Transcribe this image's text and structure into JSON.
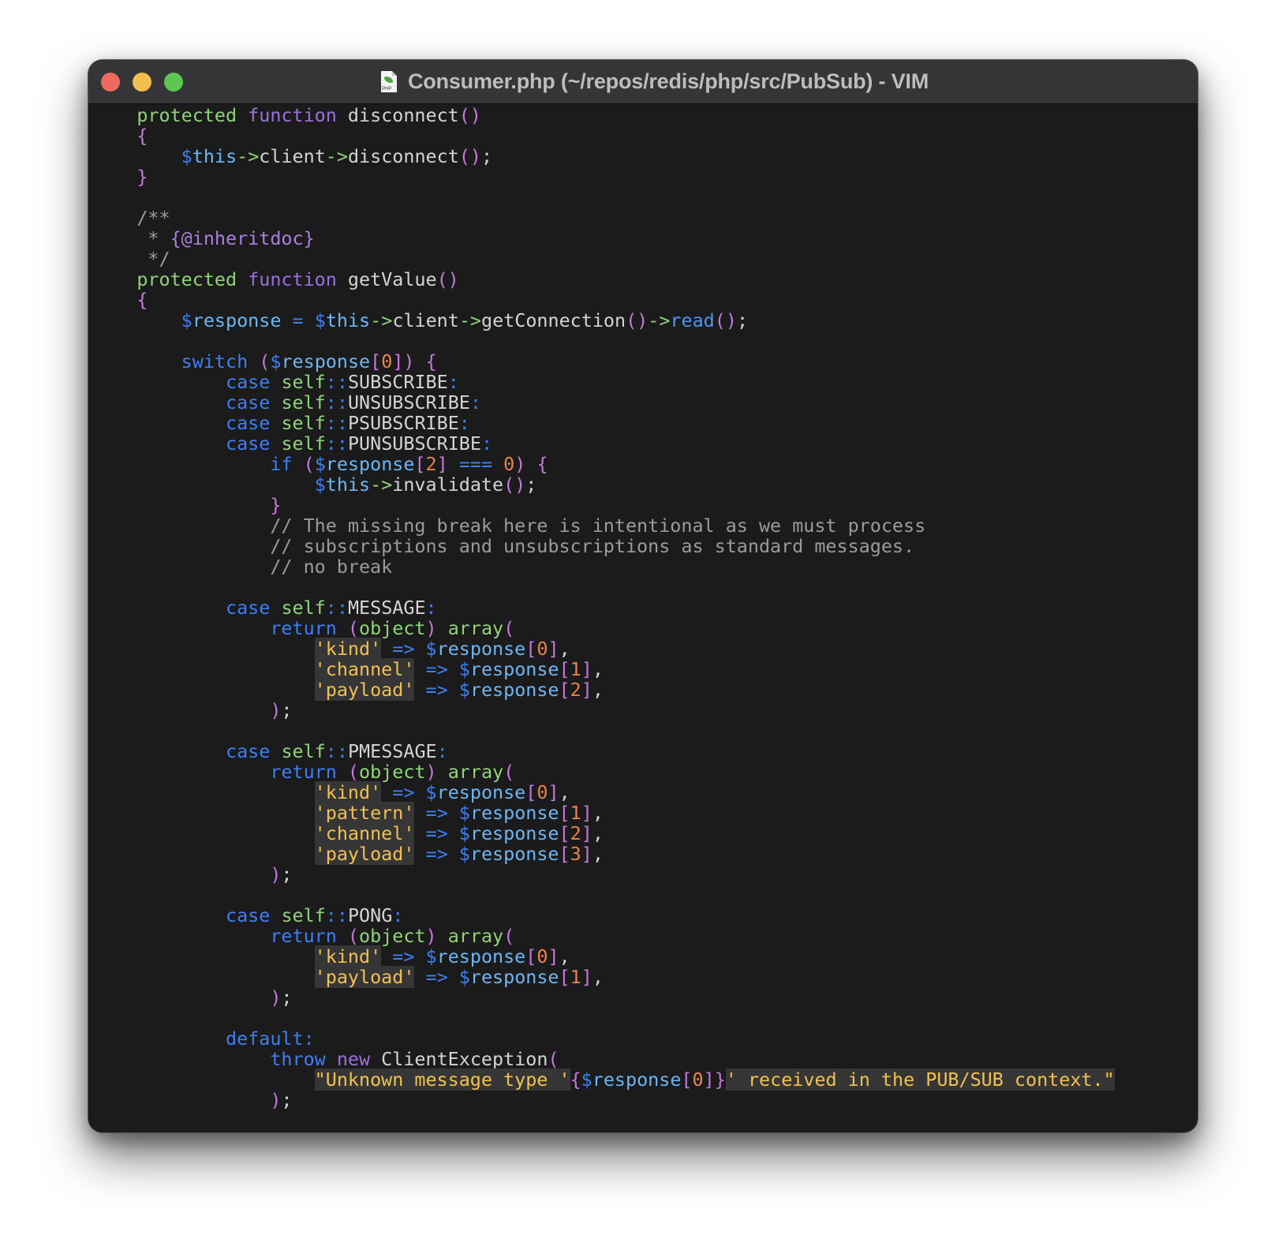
{
  "window": {
    "title": "Consumer.php (~/repos/redis/php/src/PubSub) - VIM",
    "file_icon": "php-file-icon",
    "file_icon_label": "PHP",
    "traffic_lights": [
      {
        "name": "close",
        "color": "#ee6a5f"
      },
      {
        "name": "minimize",
        "color": "#f4bf4f"
      },
      {
        "name": "maximize",
        "color": "#5fc553"
      }
    ]
  },
  "editor": {
    "language": "php",
    "colors": {
      "background": "#1b1b1b",
      "default": "#d4d4d4",
      "storage": "#8fd47a",
      "keyword": "#9d6fe0",
      "control": "#3d7ff5",
      "variable": "#6cb6f5",
      "paren": "#c678dd",
      "number": "#e8834e",
      "comment": "#9b9b9b",
      "string": "#f2c14e"
    },
    "lines": [
      [
        [
          "storage",
          "    protected"
        ],
        [
          "default",
          " "
        ],
        [
          "keyword",
          "function"
        ],
        [
          "default",
          " disconnect"
        ],
        [
          "paren",
          "()"
        ]
      ],
      [
        [
          "paren",
          "    {"
        ]
      ],
      [
        [
          "default",
          "        "
        ],
        [
          "dollar",
          "$"
        ],
        [
          "var",
          "this"
        ],
        [
          "storage",
          "->"
        ],
        [
          "default",
          "client"
        ],
        [
          "storage",
          "->"
        ],
        [
          "default",
          "disconnect"
        ],
        [
          "paren",
          "()"
        ],
        [
          "default",
          ";"
        ]
      ],
      [
        [
          "paren",
          "    }"
        ]
      ],
      [],
      [
        [
          "comment",
          "    /**"
        ]
      ],
      [
        [
          "comment",
          "     * "
        ],
        [
          "doctag",
          "{@inheritdoc}"
        ]
      ],
      [
        [
          "comment",
          "     */"
        ]
      ],
      [
        [
          "storage",
          "    protected"
        ],
        [
          "default",
          " "
        ],
        [
          "keyword",
          "function"
        ],
        [
          "default",
          " getValue"
        ],
        [
          "paren",
          "()"
        ]
      ],
      [
        [
          "paren",
          "    {"
        ]
      ],
      [
        [
          "default",
          "        "
        ],
        [
          "dollar",
          "$"
        ],
        [
          "var",
          "response"
        ],
        [
          "default",
          " "
        ],
        [
          "control",
          "="
        ],
        [
          "default",
          " "
        ],
        [
          "dollar",
          "$"
        ],
        [
          "var",
          "this"
        ],
        [
          "storage",
          "->"
        ],
        [
          "default",
          "client"
        ],
        [
          "storage",
          "->"
        ],
        [
          "default",
          "getConnection"
        ],
        [
          "paren",
          "()"
        ],
        [
          "storage",
          "->"
        ],
        [
          "builtin",
          "read"
        ],
        [
          "paren",
          "()"
        ],
        [
          "default",
          ";"
        ]
      ],
      [],
      [
        [
          "default",
          "        "
        ],
        [
          "control",
          "switch"
        ],
        [
          "default",
          " "
        ],
        [
          "paren",
          "("
        ],
        [
          "dollar",
          "$"
        ],
        [
          "var",
          "response"
        ],
        [
          "paren",
          "["
        ],
        [
          "number",
          "0"
        ],
        [
          "paren",
          "])"
        ],
        [
          "default",
          " "
        ],
        [
          "paren",
          "{"
        ]
      ],
      [
        [
          "default",
          "            "
        ],
        [
          "control",
          "case"
        ],
        [
          "default",
          " "
        ],
        [
          "storage",
          "self"
        ],
        [
          "control",
          "::"
        ],
        [
          "default",
          "SUBSCRIBE"
        ],
        [
          "control",
          ":"
        ]
      ],
      [
        [
          "default",
          "            "
        ],
        [
          "control",
          "case"
        ],
        [
          "default",
          " "
        ],
        [
          "storage",
          "self"
        ],
        [
          "control",
          "::"
        ],
        [
          "default",
          "UNSUBSCRIBE"
        ],
        [
          "control",
          ":"
        ]
      ],
      [
        [
          "default",
          "            "
        ],
        [
          "control",
          "case"
        ],
        [
          "default",
          " "
        ],
        [
          "storage",
          "self"
        ],
        [
          "control",
          "::"
        ],
        [
          "default",
          "PSUBSCRIBE"
        ],
        [
          "control",
          ":"
        ]
      ],
      [
        [
          "default",
          "            "
        ],
        [
          "control",
          "case"
        ],
        [
          "default",
          " "
        ],
        [
          "storage",
          "self"
        ],
        [
          "control",
          "::"
        ],
        [
          "default",
          "PUNSUBSCRIBE"
        ],
        [
          "control",
          ":"
        ]
      ],
      [
        [
          "default",
          "                "
        ],
        [
          "control",
          "if"
        ],
        [
          "default",
          " "
        ],
        [
          "paren",
          "("
        ],
        [
          "dollar",
          "$"
        ],
        [
          "var",
          "response"
        ],
        [
          "paren",
          "["
        ],
        [
          "number",
          "2"
        ],
        [
          "paren",
          "]"
        ],
        [
          "default",
          " "
        ],
        [
          "control",
          "==="
        ],
        [
          "default",
          " "
        ],
        [
          "number",
          "0"
        ],
        [
          "paren",
          ")"
        ],
        [
          "default",
          " "
        ],
        [
          "paren",
          "{"
        ]
      ],
      [
        [
          "default",
          "                    "
        ],
        [
          "dollar",
          "$"
        ],
        [
          "var",
          "this"
        ],
        [
          "storage",
          "->"
        ],
        [
          "default",
          "invalidate"
        ],
        [
          "paren",
          "()"
        ],
        [
          "default",
          ";"
        ]
      ],
      [
        [
          "paren",
          "                }"
        ]
      ],
      [
        [
          "comment",
          "                // The missing break here is intentional as we must process"
        ]
      ],
      [
        [
          "comment",
          "                // subscriptions and unsubscriptions as standard messages."
        ]
      ],
      [
        [
          "comment",
          "                // no break"
        ]
      ],
      [],
      [
        [
          "default",
          "            "
        ],
        [
          "control",
          "case"
        ],
        [
          "default",
          " "
        ],
        [
          "storage",
          "self"
        ],
        [
          "control",
          "::"
        ],
        [
          "default",
          "MESSAGE"
        ],
        [
          "control",
          ":"
        ]
      ],
      [
        [
          "default",
          "                "
        ],
        [
          "control",
          "return"
        ],
        [
          "default",
          " "
        ],
        [
          "paren",
          "("
        ],
        [
          "storage",
          "object"
        ],
        [
          "paren",
          ")"
        ],
        [
          "default",
          " "
        ],
        [
          "storage",
          "array"
        ],
        [
          "paren",
          "("
        ]
      ],
      [
        [
          "default",
          "                    "
        ],
        [
          "string",
          "'kind'"
        ],
        [
          "default",
          " "
        ],
        [
          "control",
          "=>"
        ],
        [
          "default",
          " "
        ],
        [
          "dollar",
          "$"
        ],
        [
          "var",
          "response"
        ],
        [
          "paren",
          "["
        ],
        [
          "number",
          "0"
        ],
        [
          "paren",
          "]"
        ],
        [
          "default",
          ","
        ]
      ],
      [
        [
          "default",
          "                    "
        ],
        [
          "string",
          "'channel'"
        ],
        [
          "default",
          " "
        ],
        [
          "control",
          "=>"
        ],
        [
          "default",
          " "
        ],
        [
          "dollar",
          "$"
        ],
        [
          "var",
          "response"
        ],
        [
          "paren",
          "["
        ],
        [
          "number",
          "1"
        ],
        [
          "paren",
          "]"
        ],
        [
          "default",
          ","
        ]
      ],
      [
        [
          "default",
          "                    "
        ],
        [
          "string",
          "'payload'"
        ],
        [
          "default",
          " "
        ],
        [
          "control",
          "=>"
        ],
        [
          "default",
          " "
        ],
        [
          "dollar",
          "$"
        ],
        [
          "var",
          "response"
        ],
        [
          "paren",
          "["
        ],
        [
          "number",
          "2"
        ],
        [
          "paren",
          "]"
        ],
        [
          "default",
          ","
        ]
      ],
      [
        [
          "paren",
          "                )"
        ],
        [
          "default",
          ";"
        ]
      ],
      [],
      [
        [
          "default",
          "            "
        ],
        [
          "control",
          "case"
        ],
        [
          "default",
          " "
        ],
        [
          "storage",
          "self"
        ],
        [
          "control",
          "::"
        ],
        [
          "default",
          "PMESSAGE"
        ],
        [
          "control",
          ":"
        ]
      ],
      [
        [
          "default",
          "                "
        ],
        [
          "control",
          "return"
        ],
        [
          "default",
          " "
        ],
        [
          "paren",
          "("
        ],
        [
          "storage",
          "object"
        ],
        [
          "paren",
          ")"
        ],
        [
          "default",
          " "
        ],
        [
          "storage",
          "array"
        ],
        [
          "paren",
          "("
        ]
      ],
      [
        [
          "default",
          "                    "
        ],
        [
          "string",
          "'kind'"
        ],
        [
          "default",
          " "
        ],
        [
          "control",
          "=>"
        ],
        [
          "default",
          " "
        ],
        [
          "dollar",
          "$"
        ],
        [
          "var",
          "response"
        ],
        [
          "paren",
          "["
        ],
        [
          "number",
          "0"
        ],
        [
          "paren",
          "]"
        ],
        [
          "default",
          ","
        ]
      ],
      [
        [
          "default",
          "                    "
        ],
        [
          "string",
          "'pattern'"
        ],
        [
          "default",
          " "
        ],
        [
          "control",
          "=>"
        ],
        [
          "default",
          " "
        ],
        [
          "dollar",
          "$"
        ],
        [
          "var",
          "response"
        ],
        [
          "paren",
          "["
        ],
        [
          "number",
          "1"
        ],
        [
          "paren",
          "]"
        ],
        [
          "default",
          ","
        ]
      ],
      [
        [
          "default",
          "                    "
        ],
        [
          "string",
          "'channel'"
        ],
        [
          "default",
          " "
        ],
        [
          "control",
          "=>"
        ],
        [
          "default",
          " "
        ],
        [
          "dollar",
          "$"
        ],
        [
          "var",
          "response"
        ],
        [
          "paren",
          "["
        ],
        [
          "number",
          "2"
        ],
        [
          "paren",
          "]"
        ],
        [
          "default",
          ","
        ]
      ],
      [
        [
          "default",
          "                    "
        ],
        [
          "string",
          "'payload'"
        ],
        [
          "default",
          " "
        ],
        [
          "control",
          "=>"
        ],
        [
          "default",
          " "
        ],
        [
          "dollar",
          "$"
        ],
        [
          "var",
          "response"
        ],
        [
          "paren",
          "["
        ],
        [
          "number",
          "3"
        ],
        [
          "paren",
          "]"
        ],
        [
          "default",
          ","
        ]
      ],
      [
        [
          "paren",
          "                )"
        ],
        [
          "default",
          ";"
        ]
      ],
      [],
      [
        [
          "default",
          "            "
        ],
        [
          "control",
          "case"
        ],
        [
          "default",
          " "
        ],
        [
          "storage",
          "self"
        ],
        [
          "control",
          "::"
        ],
        [
          "default",
          "PONG"
        ],
        [
          "control",
          ":"
        ]
      ],
      [
        [
          "default",
          "                "
        ],
        [
          "control",
          "return"
        ],
        [
          "default",
          " "
        ],
        [
          "paren",
          "("
        ],
        [
          "storage",
          "object"
        ],
        [
          "paren",
          ")"
        ],
        [
          "default",
          " "
        ],
        [
          "storage",
          "array"
        ],
        [
          "paren",
          "("
        ]
      ],
      [
        [
          "default",
          "                    "
        ],
        [
          "string",
          "'kind'"
        ],
        [
          "default",
          " "
        ],
        [
          "control",
          "=>"
        ],
        [
          "default",
          " "
        ],
        [
          "dollar",
          "$"
        ],
        [
          "var",
          "response"
        ],
        [
          "paren",
          "["
        ],
        [
          "number",
          "0"
        ],
        [
          "paren",
          "]"
        ],
        [
          "default",
          ","
        ]
      ],
      [
        [
          "default",
          "                    "
        ],
        [
          "string",
          "'payload'"
        ],
        [
          "default",
          " "
        ],
        [
          "control",
          "=>"
        ],
        [
          "default",
          " "
        ],
        [
          "dollar",
          "$"
        ],
        [
          "var",
          "response"
        ],
        [
          "paren",
          "["
        ],
        [
          "number",
          "1"
        ],
        [
          "paren",
          "]"
        ],
        [
          "default",
          ","
        ]
      ],
      [
        [
          "paren",
          "                )"
        ],
        [
          "default",
          ";"
        ]
      ],
      [],
      [
        [
          "default",
          "            "
        ],
        [
          "control",
          "default:"
        ]
      ],
      [
        [
          "default",
          "                "
        ],
        [
          "control",
          "throw"
        ],
        [
          "default",
          " "
        ],
        [
          "keyword",
          "new"
        ],
        [
          "default",
          " ClientException"
        ],
        [
          "paren",
          "("
        ]
      ],
      [
        [
          "default",
          "                    "
        ],
        [
          "string",
          "\"Unknown message type '"
        ],
        [
          "paren",
          "{"
        ],
        [
          "dollar",
          "$"
        ],
        [
          "var",
          "response"
        ],
        [
          "paren",
          "["
        ],
        [
          "number",
          "0"
        ],
        [
          "paren",
          "]}"
        ],
        [
          "string",
          "' received in the PUB/SUB context.\""
        ]
      ],
      [
        [
          "paren",
          "                )"
        ],
        [
          "default",
          ";"
        ]
      ]
    ]
  }
}
